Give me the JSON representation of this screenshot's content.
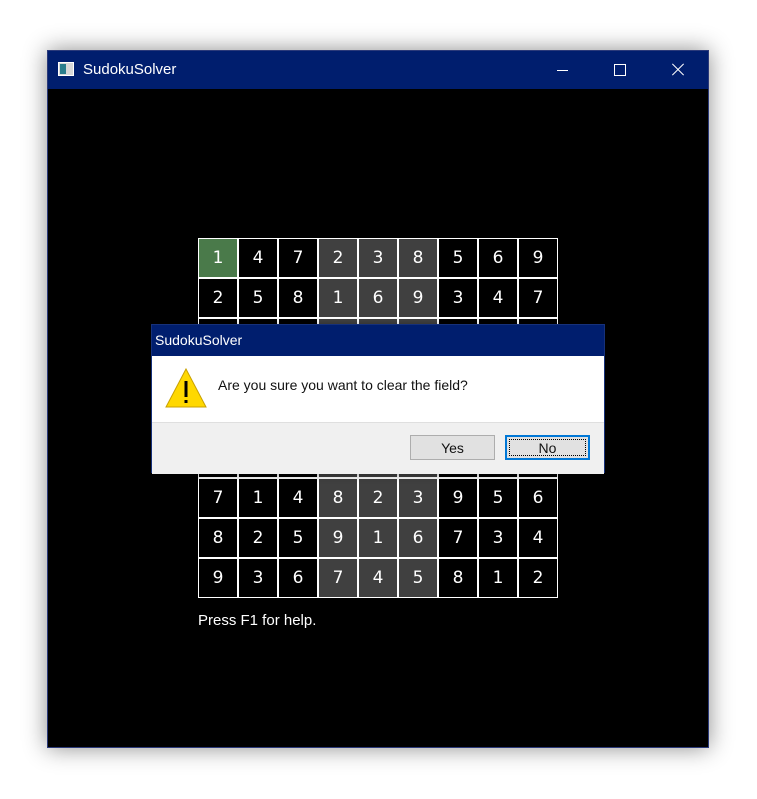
{
  "window": {
    "title": "SudokuSolver",
    "icon": "app-icon",
    "controls": [
      "minimize-icon",
      "maximize-icon",
      "close-icon"
    ]
  },
  "colors": {
    "titlebar": "#001e6e",
    "cell_default": "#000000",
    "cell_shaded": "#404040",
    "cell_selected": "#4a7a4a",
    "grid_line": "#ffffff"
  },
  "board": {
    "rows": [
      [
        "1",
        "4",
        "7",
        "2",
        "3",
        "8",
        "5",
        "6",
        "9"
      ],
      [
        "2",
        "5",
        "8",
        "1",
        "6",
        "9",
        "3",
        "4",
        "7"
      ],
      [
        "",
        "",
        "",
        "",
        "",
        "",
        "",
        "",
        ""
      ],
      [
        "",
        "",
        "",
        "",
        "",
        "",
        "",
        "",
        ""
      ],
      [
        "",
        "",
        "",
        "",
        "",
        "",
        "",
        "",
        ""
      ],
      [
        "",
        "",
        "",
        "",
        "",
        "",
        "",
        "",
        ""
      ],
      [
        "7",
        "1",
        "4",
        "8",
        "2",
        "3",
        "9",
        "5",
        "6"
      ],
      [
        "8",
        "2",
        "5",
        "9",
        "1",
        "6",
        "7",
        "3",
        "4"
      ],
      [
        "9",
        "3",
        "6",
        "7",
        "4",
        "5",
        "8",
        "1",
        "2"
      ]
    ],
    "selected": [
      0,
      0
    ]
  },
  "help_text": "Press F1 for help.",
  "dialog": {
    "title": "SudokuSolver",
    "icon": "warning-icon",
    "message": "Are you sure you want to clear the field?",
    "yes_label": "Yes",
    "no_label": "No",
    "default_button": "No"
  }
}
